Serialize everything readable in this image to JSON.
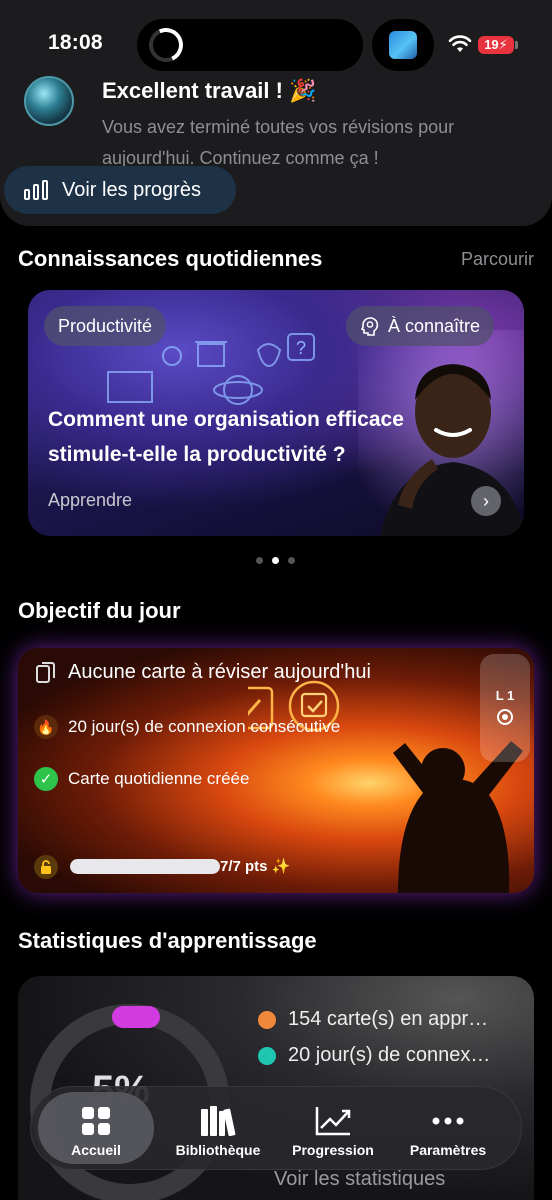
{
  "status_bar": {
    "time": "18:08",
    "battery": "19"
  },
  "notification": {
    "title": "Excellent travail ! 🎉",
    "body": "Vous avez terminé toutes vos révisions pour aujourd'hui. Continuez comme ça !",
    "progress_button": "Voir les progrès"
  },
  "knowledge": {
    "section_title": "Connaissances quotidiennes",
    "browse_link": "Parcourir",
    "card": {
      "category": "Productivité",
      "badge": "À connaître",
      "title": "Comment une organisation efficace stimule-t-elle la productivité ?",
      "action": "Apprendre"
    },
    "pagination": {
      "total": 3,
      "active": 2
    }
  },
  "goal": {
    "section_title": "Objectif du jour",
    "items": [
      {
        "icon": "cards-icon",
        "text": "Aucune carte à réviser aujourd'hui"
      },
      {
        "icon": "fire-icon",
        "text": "20 jour(s) de connexion consécutive"
      },
      {
        "icon": "check-badge-icon",
        "text": "Carte quotidienne créée"
      }
    ],
    "level": "L 1",
    "progress_value": 1.0,
    "points": "7/7 pts ✨"
  },
  "stats": {
    "section_title": "Statistiques d'apprentissage",
    "percent": "5%",
    "legend": [
      {
        "text": "154 carte(s) en appr…",
        "color": "#f0883a"
      },
      {
        "text": "20 jour(s) de connex…",
        "color": "#1fc7b0"
      }
    ],
    "link": "Voir les statistiques"
  },
  "tabbar": {
    "tabs": [
      {
        "label": "Accueil",
        "icon": "grid-icon",
        "active": true
      },
      {
        "label": "Bibliothèque",
        "icon": "books-icon",
        "active": false
      },
      {
        "label": "Progression",
        "icon": "chart-icon",
        "active": false
      },
      {
        "label": "Paramètres",
        "icon": "more-icon",
        "active": false
      }
    ]
  }
}
